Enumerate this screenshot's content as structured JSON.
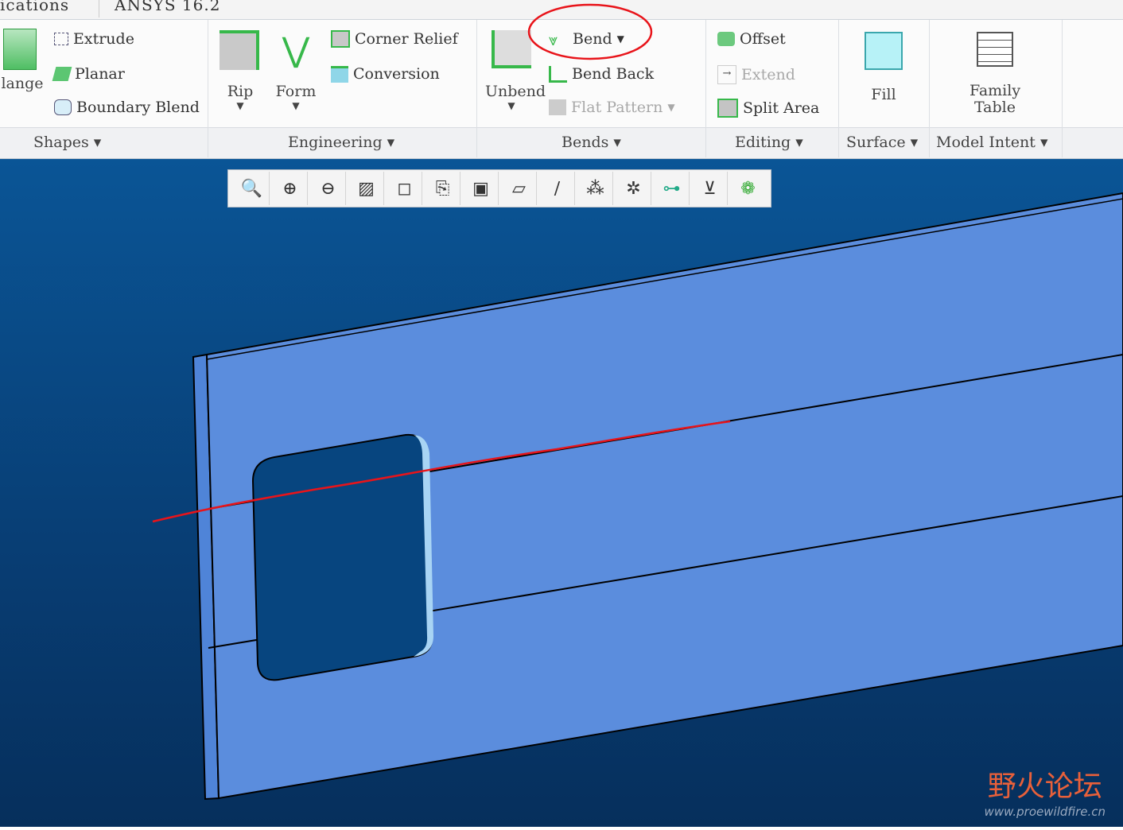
{
  "tabs": [
    "ications",
    "ANSYS 16.2"
  ],
  "ribbon": {
    "shapes": {
      "flange": "lange",
      "extrude": "Extrude",
      "planar": "Planar",
      "boundary_blend": "Boundary Blend",
      "label": "Shapes ▾"
    },
    "engineering": {
      "rip": "Rip",
      "form": "Form",
      "corner_relief": "Corner Relief",
      "conversion": "Conversion",
      "label": "Engineering ▾"
    },
    "bends": {
      "unbend": "Unbend",
      "bend": "Bend",
      "bend_back": "Bend Back",
      "flat_pattern": "Flat Pattern",
      "label": "Bends ▾"
    },
    "editing": {
      "offset": "Offset",
      "extend": "Extend",
      "split_area": "Split Area",
      "label": "Editing ▾"
    },
    "surface": {
      "fill": "Fill",
      "label": "Surface ▾"
    },
    "model_intent": {
      "family_table_1": "Family",
      "family_table_2": "Table",
      "label": "Model Intent ▾"
    }
  },
  "view_toolbar": [
    "zoom-fit-icon",
    "zoom-in-icon",
    "zoom-out-icon",
    "repaint-icon",
    "display-style-icon",
    "saved-views-icon",
    "view-manager-icon",
    "datum-plane-icon",
    "axis-display-icon",
    "point-display-icon",
    "csys-display-icon",
    "spin-center-icon",
    "annotation-icon",
    "appearance-icon"
  ],
  "watermark": {
    "cn": "野火论坛",
    "url": "www.proewildfire.cn"
  },
  "colors": {
    "annotation": "#e8141a",
    "model_face": "#5b8ddd",
    "viewport": "#0a5596"
  }
}
